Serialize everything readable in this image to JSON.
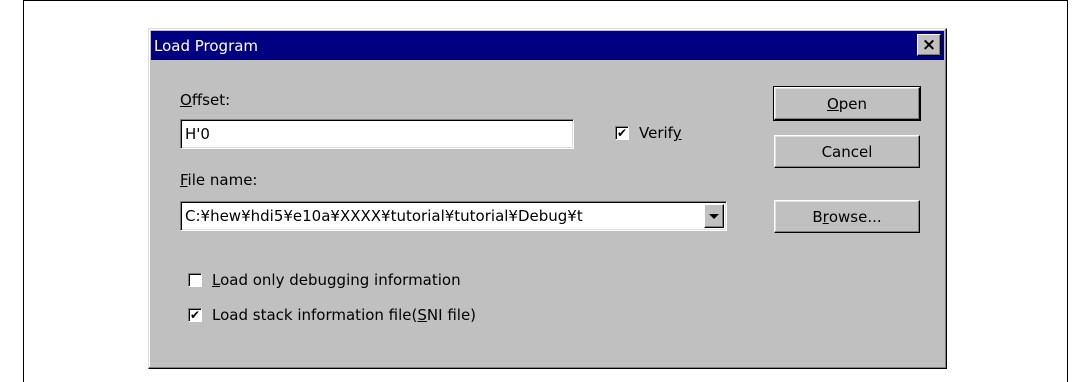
{
  "dialog": {
    "title": "Load Program",
    "close_label": "×"
  },
  "offset": {
    "label_mnemonic": "O",
    "label_rest": "ffset:",
    "value": "H'0"
  },
  "verify": {
    "label_pre": "Verif",
    "label_mnemonic": "y",
    "checked": true
  },
  "file_name": {
    "label_mnemonic": "F",
    "label_rest": "ile name:",
    "value": "C:¥hew¥hdi5¥e10a¥XXXX¥tutorial¥tutorial¥Debug¥t"
  },
  "buttons": {
    "open_mnemonic": "O",
    "open_rest": "pen",
    "cancel": "Cancel",
    "browse_pre": "B",
    "browse_mnemonic": "r",
    "browse_rest": "owse..."
  },
  "options": [
    {
      "pre": "",
      "mnemonic": "L",
      "rest": "oad only debugging information",
      "checked": false
    },
    {
      "pre": "Load stack information file(",
      "mnemonic": "S",
      "rest": "NI file)",
      "checked": true
    }
  ],
  "check_glyph": "✔"
}
